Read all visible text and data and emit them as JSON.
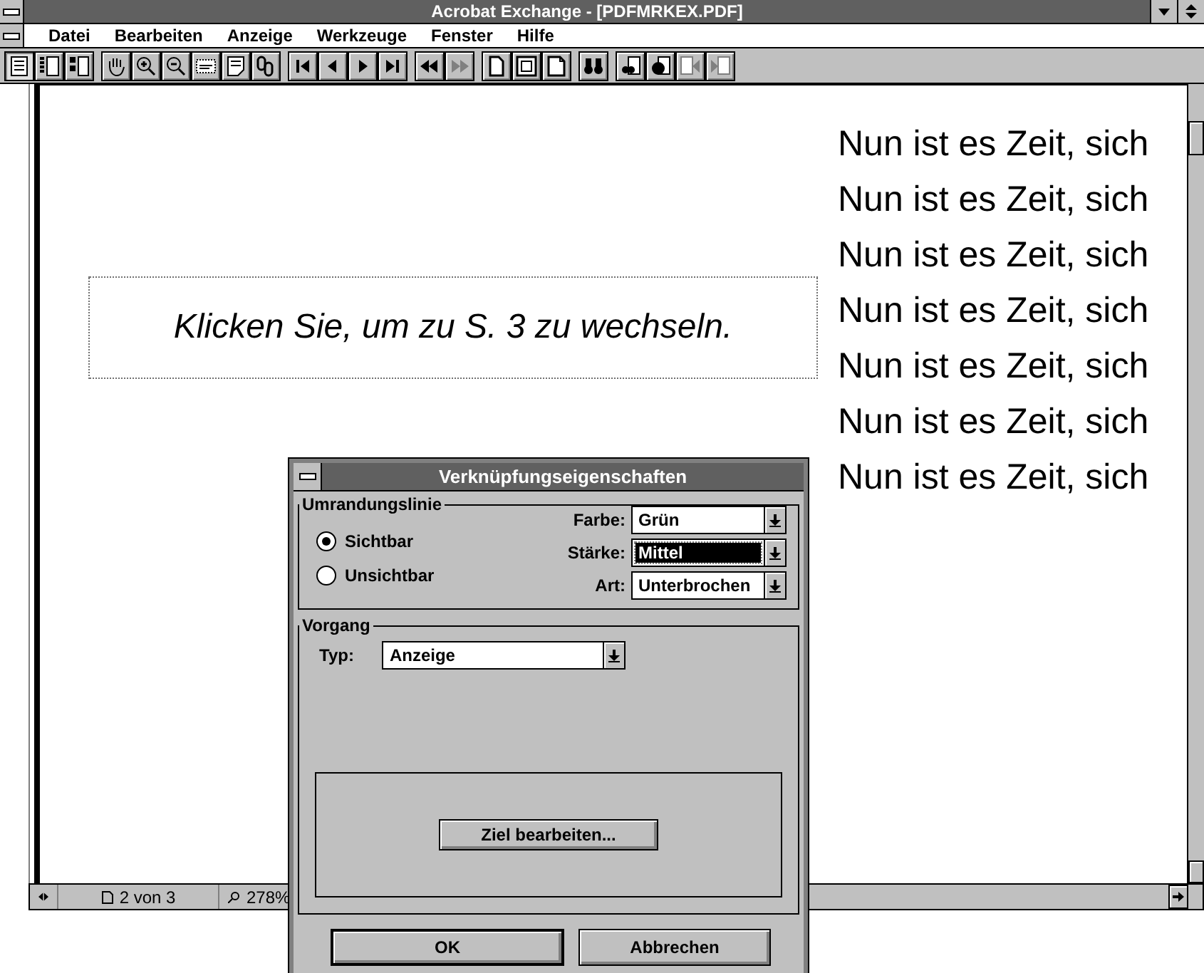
{
  "window": {
    "title": "Acrobat Exchange - [PDFMRKEX.PDF]"
  },
  "menu": [
    {
      "label": "Datei"
    },
    {
      "label": "Bearbeiten"
    },
    {
      "label": "Anzeige"
    },
    {
      "label": "Werkzeuge"
    },
    {
      "label": "Fenster"
    },
    {
      "label": "Hilfe"
    }
  ],
  "toolbar": {
    "groups": [
      [
        {
          "kind": "page",
          "pressed": true,
          "disabled": false
        },
        {
          "kind": "bookmarks",
          "pressed": false,
          "disabled": false
        },
        {
          "kind": "thumbnails",
          "pressed": false,
          "disabled": false
        }
      ],
      [
        {
          "kind": "hand",
          "pressed": false,
          "disabled": false
        },
        {
          "kind": "zoomin",
          "pressed": false,
          "disabled": false
        },
        {
          "kind": "zoomout",
          "pressed": false,
          "disabled": false
        },
        {
          "kind": "textselect",
          "pressed": false,
          "disabled": false
        },
        {
          "kind": "note",
          "pressed": false,
          "disabled": false
        },
        {
          "kind": "link",
          "pressed": false,
          "disabled": false
        }
      ],
      [
        {
          "kind": "first",
          "pressed": false,
          "disabled": false
        },
        {
          "kind": "prev",
          "pressed": false,
          "disabled": false
        },
        {
          "kind": "next",
          "pressed": false,
          "disabled": false
        },
        {
          "kind": "last",
          "pressed": false,
          "disabled": false
        }
      ],
      [
        {
          "kind": "back",
          "pressed": false,
          "disabled": false
        },
        {
          "kind": "forward",
          "pressed": false,
          "disabled": true
        }
      ],
      [
        {
          "kind": "actualsize",
          "pressed": false,
          "disabled": false
        },
        {
          "kind": "fitpage",
          "pressed": false,
          "disabled": false
        },
        {
          "kind": "fitwidth",
          "pressed": false,
          "disabled": false
        }
      ],
      [
        {
          "kind": "find",
          "pressed": false,
          "disabled": false
        }
      ],
      [
        {
          "kind": "search",
          "pressed": false,
          "disabled": false
        },
        {
          "kind": "results",
          "pressed": false,
          "disabled": false
        },
        {
          "kind": "prevhit",
          "pressed": false,
          "disabled": true
        },
        {
          "kind": "nexthit",
          "pressed": false,
          "disabled": true
        }
      ]
    ]
  },
  "document": {
    "link_text": "Klicken Sie, um zu S. 3 zu wechseln.",
    "lines": [
      "Nun ist es Zeit, sich",
      "Nun ist es Zeit, sich",
      "Nun ist es Zeit, sich",
      "Nun ist es Zeit, sich",
      "Nun ist es Zeit, sich",
      "Nun ist es Zeit, sich",
      "Nun ist es Zeit, sich"
    ]
  },
  "status_bar": {
    "page": "2 von 3",
    "zoom": "278%"
  },
  "dialog": {
    "title": "Verknüpfungseigenschaften",
    "border_group": {
      "title": "Umrandungslinie",
      "options": [
        {
          "label": "Sichtbar",
          "selected": true
        },
        {
          "label": "Unsichtbar",
          "selected": false
        }
      ],
      "fields": [
        {
          "label": "Farbe:",
          "value": "Grün",
          "focused": false
        },
        {
          "label": "Stärke:",
          "value": "Mittel",
          "focused": true
        },
        {
          "label": "Art:",
          "value": "Unterbrochen",
          "focused": false
        }
      ]
    },
    "action_group": {
      "title": "Vorgang",
      "type_label": "Typ:",
      "type_value": "Anzeige",
      "edit_button": "Ziel bearbeiten..."
    },
    "buttons": [
      {
        "label": "OK",
        "default": true
      },
      {
        "label": "Abbrechen",
        "default": false
      }
    ]
  }
}
